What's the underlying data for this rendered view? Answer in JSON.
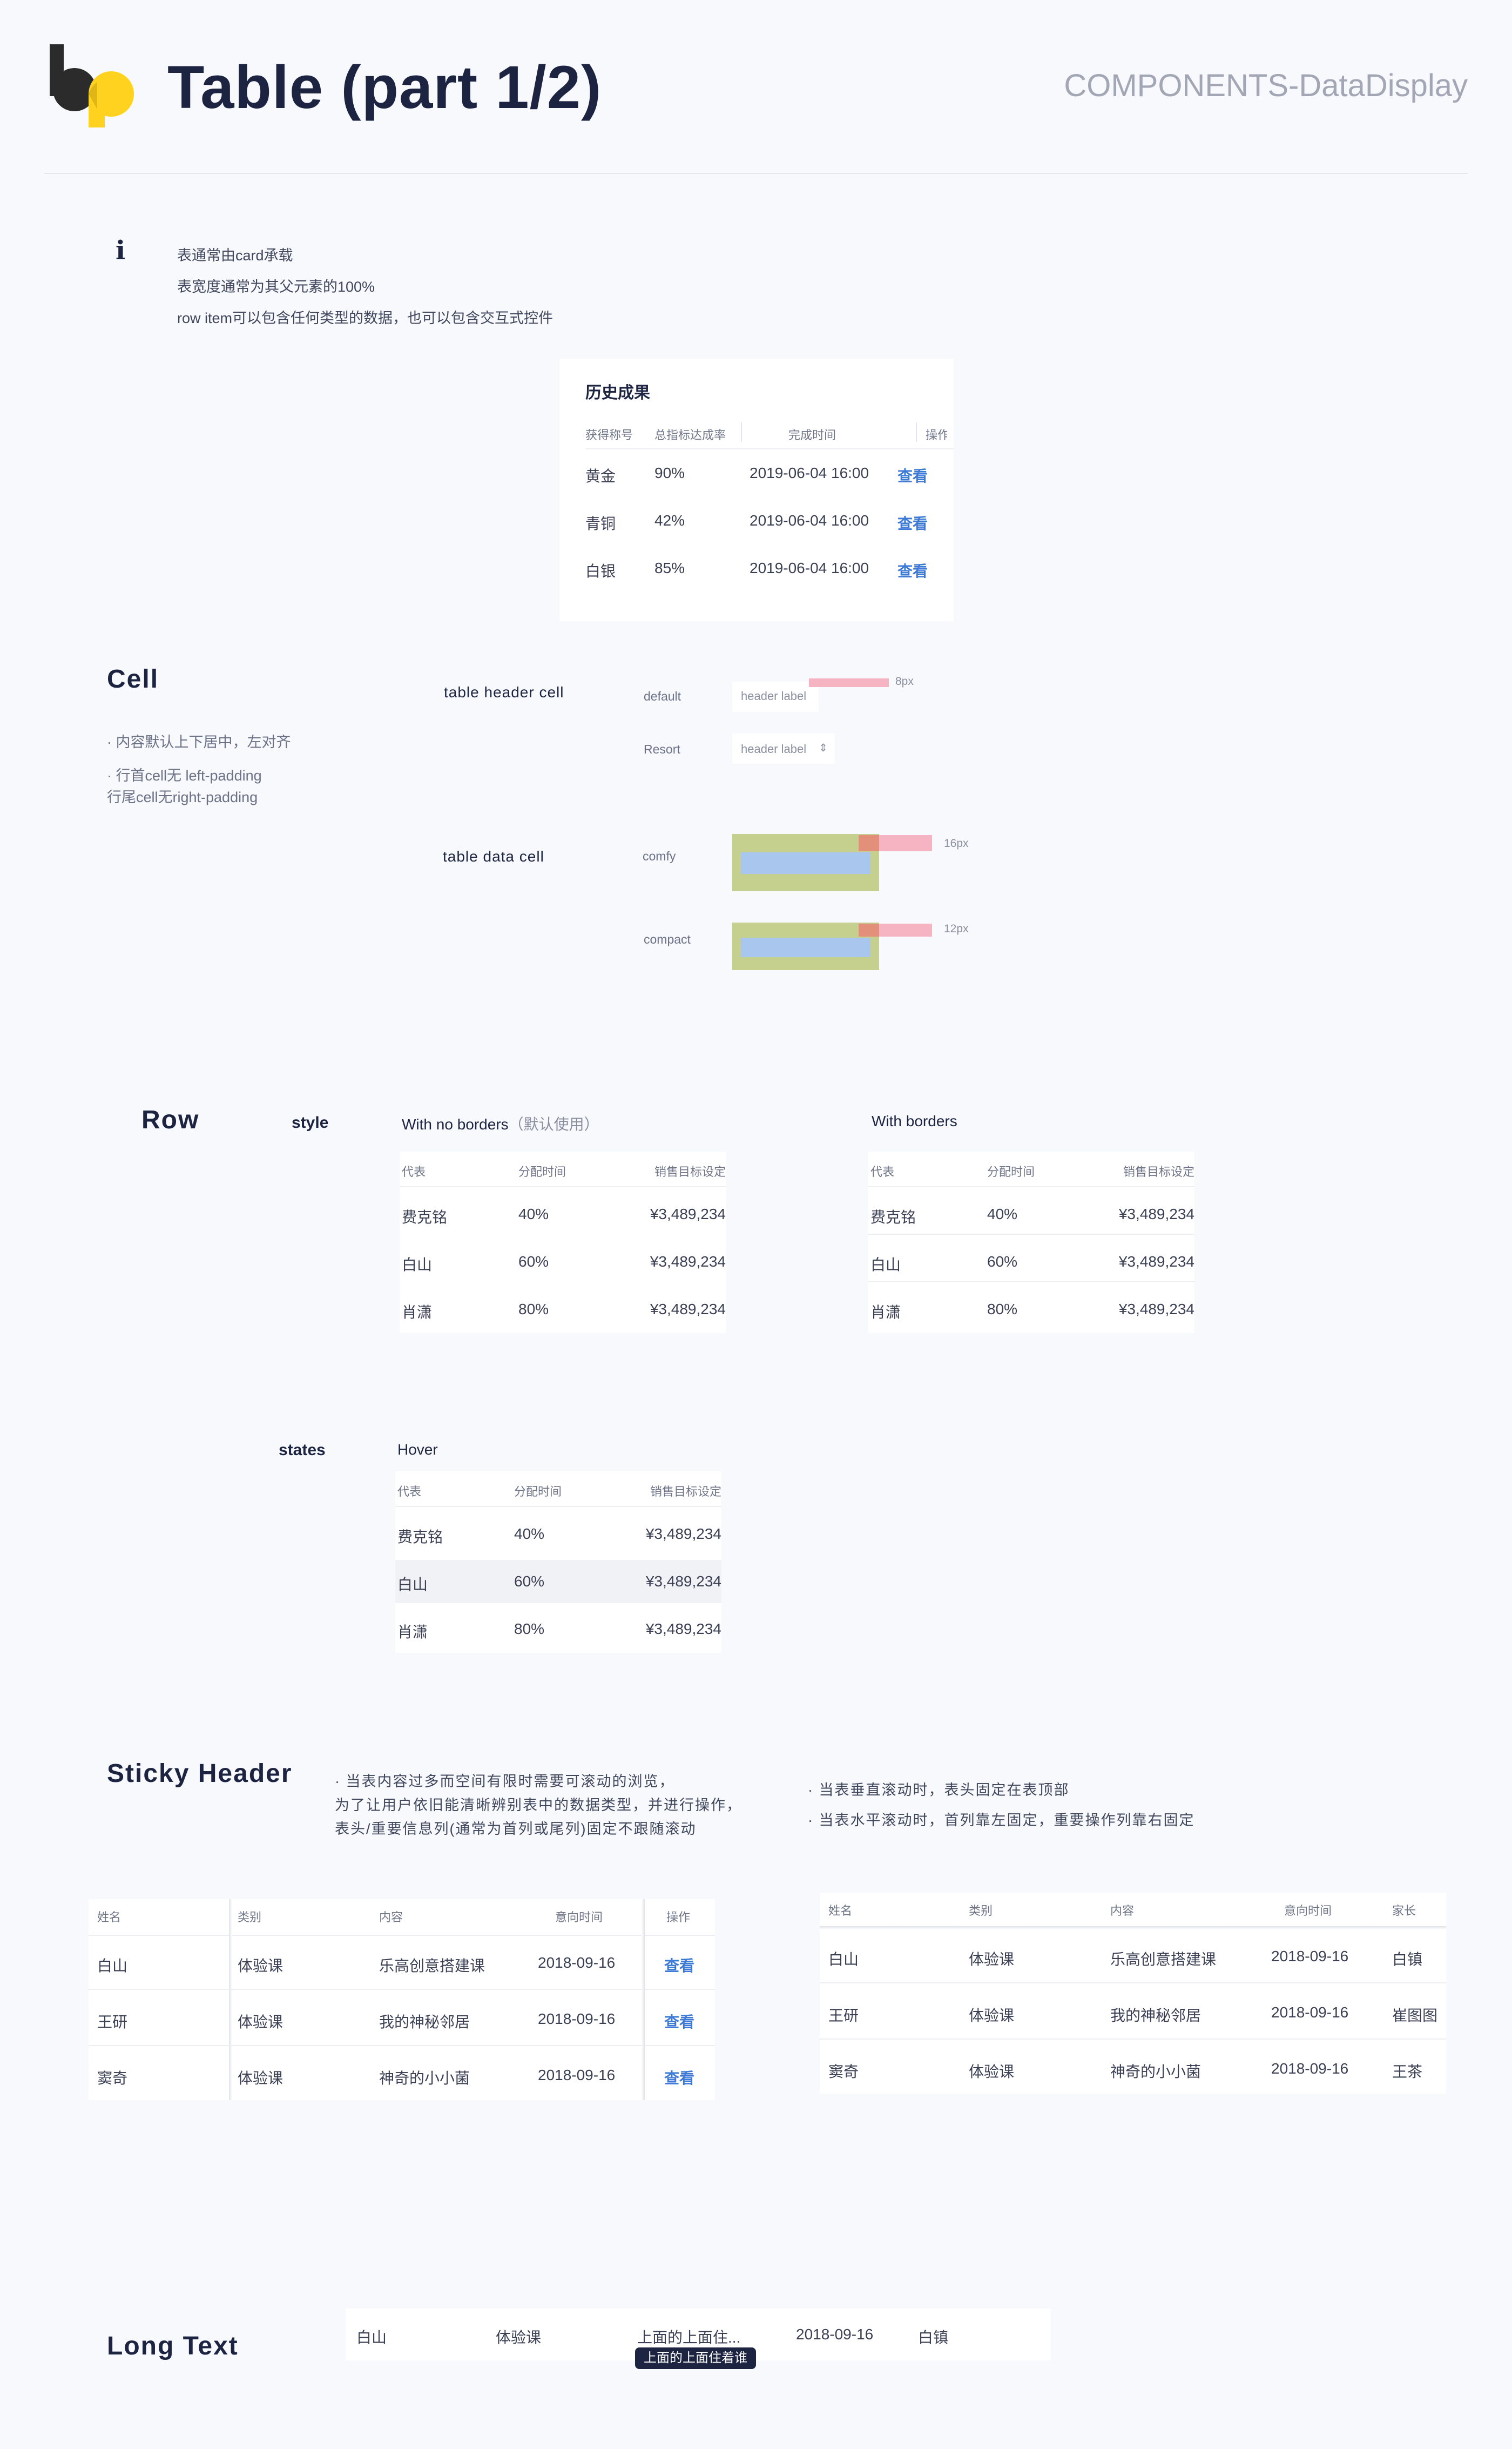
{
  "header": {
    "title": "Table (part 1/2)",
    "category": "COMPONENTS-DataDisplay"
  },
  "info": {
    "lines": [
      "表通常由card承载",
      "表宽度通常为其父元素的100%",
      "row item可以包含任何类型的数据，也可以包含交互式控件"
    ]
  },
  "example": {
    "title": "历史成果",
    "columns": [
      "获得称号",
      "总指标达成率",
      "完成时间",
      "操作"
    ],
    "rows": [
      {
        "title": "黄金",
        "rate": "90%",
        "time": "2019-06-04 16:00",
        "action": "查看"
      },
      {
        "title": "青铜",
        "rate": "42%",
        "time": "2019-06-04 16:00",
        "action": "查看"
      },
      {
        "title": "白银",
        "rate": "85%",
        "time": "2019-06-04 16:00",
        "action": "查看"
      }
    ]
  },
  "cell": {
    "title": "Cell",
    "notes": [
      "· 内容默认上下居中，左对齐",
      "· 行首cell无 left-padding",
      "行尾cell无right-padding"
    ],
    "header_cell_label": "table header cell",
    "data_cell_label": "table data cell",
    "default_label": "default",
    "resort_label": "Resort",
    "header_label": "header label",
    "sort_glyph": "⇕",
    "comfy_label": "comfy",
    "compact_label": "compact",
    "dim_8": "8px",
    "dim_16": "16px",
    "dim_12": "12px"
  },
  "row": {
    "title": "Row",
    "style_label": "style",
    "states_label": "states",
    "no_borders_label": "With  no borders",
    "default_note": "（默认使用）",
    "borders_label": "With  borders",
    "hover_label": "Hover",
    "columns": [
      "代表",
      "分配时间",
      "销售目标设定"
    ],
    "rows": [
      {
        "name": "费克铭",
        "pct": "40%",
        "amount": "¥3,489,234"
      },
      {
        "name": "白山",
        "pct": "60%",
        "amount": "¥3,489,234"
      },
      {
        "name": "肖潇",
        "pct": "80%",
        "amount": "¥3,489,234"
      }
    ]
  },
  "sticky": {
    "title": "Sticky Header",
    "desc": [
      "· 当表内容过多而空间有限时需要可滚动的浏览，",
      "为了让用户依旧能清晰辨别表中的数据类型，并进行操作，",
      "表头/重要信息列(通常为首列或尾列)固定不跟随滚动"
    ],
    "notes": [
      "· 当表垂直滚动时，表头固定在表顶部",
      "· 当表水平滚动时，首列靠左固定，重要操作列靠右固定"
    ],
    "left_columns": [
      "姓名",
      "类别",
      "内容",
      "意向时间",
      "操作"
    ],
    "right_columns": [
      "姓名",
      "类别",
      "内容",
      "意向时间",
      "家长"
    ],
    "rows": [
      {
        "name": "白山",
        "type": "体验课",
        "content": "乐高创意搭建课",
        "date": "2018-09-16",
        "action": "查看",
        "parent": "白镇"
      },
      {
        "name": "王研",
        "type": "体验课",
        "content": "我的神秘邻居",
        "date": "2018-09-16",
        "action": "查看",
        "parent": "崔图图"
      },
      {
        "name": "窦奇",
        "type": "体验课",
        "content": "神奇的小小菌",
        "date": "2018-09-16",
        "action": "查看",
        "parent": "王茶"
      }
    ]
  },
  "long_text": {
    "title": "Long Text",
    "row": {
      "name": "白山",
      "type": "体验课",
      "content": "上面的上面住...",
      "date": "2018-09-16",
      "parent": "白镇"
    },
    "tooltip": "上面的上面住着谁"
  },
  "colors": {
    "navy": "#1c2442",
    "link": "#3d7ad6",
    "padding_green": "#c5d08f",
    "content_blue": "#a9c7ee",
    "spacing_pink": "#f6b3c2"
  }
}
